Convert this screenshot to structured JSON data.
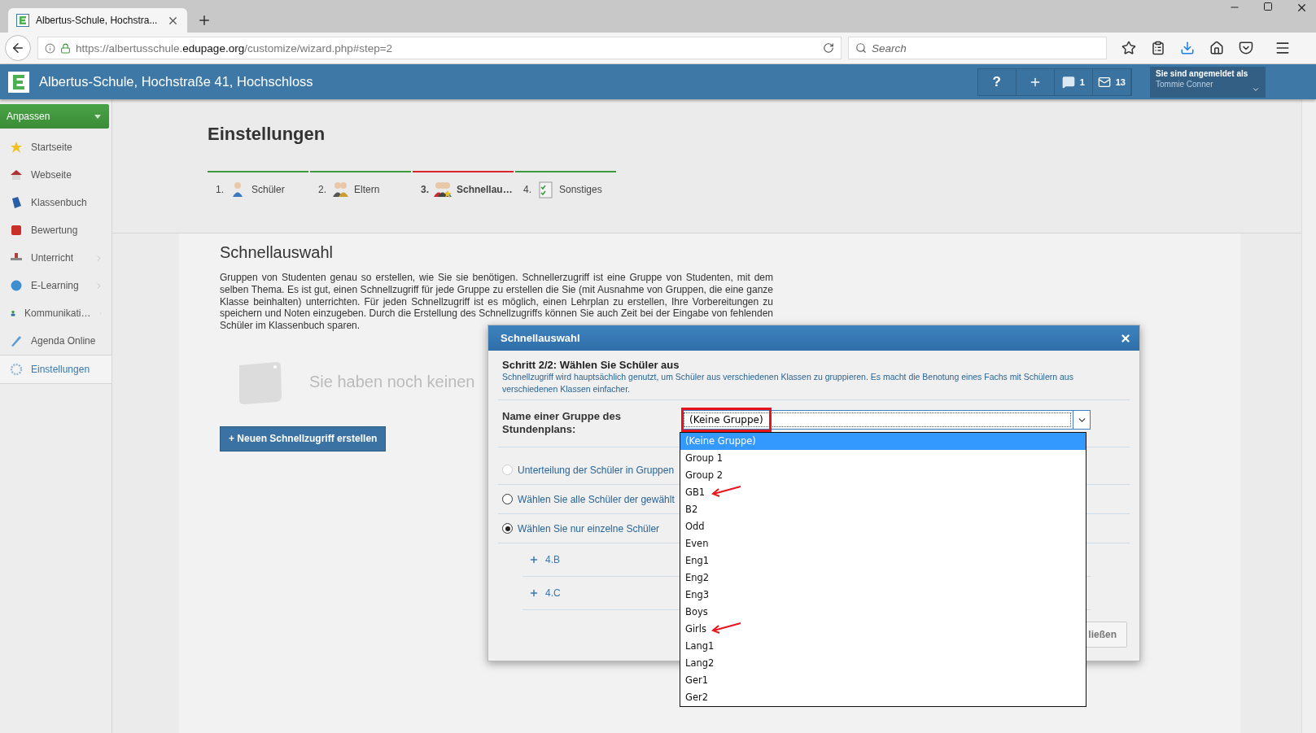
{
  "browser": {
    "tab_title": "Albertus-Schule, Hochstra...",
    "url": {
      "before": "https://albertusschule.",
      "domain": "edupage.org",
      "after": "/customize/wizard.php#step=2"
    },
    "search_placeholder": "Search"
  },
  "app_header": {
    "title": "Albertus-Schule, Hochstraße 41, Hochschloss",
    "help": "?",
    "chat_count": "1",
    "mail_count": "13",
    "user_label": "Sie sind angemeldet als",
    "user_name": "Tommie Conner"
  },
  "sidebar": {
    "menu_button": "Anpassen",
    "items": [
      {
        "label": "Startseite",
        "submenu": false,
        "selected": false
      },
      {
        "label": "Webseite",
        "submenu": false,
        "selected": false
      },
      {
        "label": "Klassenbuch",
        "submenu": false,
        "selected": false
      },
      {
        "label": "Bewertung",
        "submenu": false,
        "selected": false
      },
      {
        "label": "Unterricht",
        "submenu": true,
        "selected": false
      },
      {
        "label": "E-Learning",
        "submenu": true,
        "selected": false
      },
      {
        "label": "Kommunikati…",
        "submenu": true,
        "selected": false
      },
      {
        "label": "Agenda Online",
        "submenu": false,
        "selected": false
      },
      {
        "label": "Einstellungen",
        "submenu": false,
        "selected": true
      }
    ]
  },
  "page": {
    "title": "Einstellungen",
    "steps": [
      {
        "number": "1.",
        "label": "Schüler",
        "selected": false
      },
      {
        "number": "2.",
        "label": "Eltern",
        "selected": false
      },
      {
        "number": "3.",
        "label": "Schnellau…",
        "selected": true
      },
      {
        "number": "4.",
        "label": "Sonstiges",
        "selected": false
      }
    ],
    "heading": "Schnellauswahl",
    "paragraph": "Gruppen von Studenten genau so erstellen, wie Sie sie benötigen. Schnellerzugriff ist eine Gruppe von Studenten, mit dem selben Thema. Es ist gut, einen Schnellzugriff für jede Gruppe zu erstellen die Sie (mit Ausnahme von Gruppen, die eine ganze Klasse beinhalten) unterrichten. Für jeden Schnellzugriff ist es möglich, einen Lehrplan zu erstellen, Ihre Vorbereitungen zu speichern und Noten einzugeben. Durch die Erstellung des Schnellzugriffs können Sie auch Zeit bei der Eingabe von fehlenden Schüler im Klassenbuch sparen.",
    "empty_message": "Sie haben noch keinen",
    "create_button": "+ Neuen Schnellzugriff erstellen"
  },
  "modal": {
    "title": "Schnellauswahl",
    "step_title": "Schritt 2/2: Wählen Sie Schüler aus",
    "description": "Schnellzugriff wird hauptsächlich genutzt, um Schüler aus verschiedenen Klassen zu gruppieren. Es macht die Benotung eines Fachs mit Schülern aus verschiedenen Klassen einfacher.",
    "field_label": "Name einer Gruppe des Stundenplans:",
    "select_value": "(Keine Gruppe)",
    "select_highlighted": true,
    "options": [
      {
        "label": "(Keine Gruppe)",
        "selected": true,
        "marked": false
      },
      {
        "label": "Group 1",
        "selected": false,
        "marked": false
      },
      {
        "label": "Group 2",
        "selected": false,
        "marked": false
      },
      {
        "label": "GB1",
        "selected": false,
        "marked": true
      },
      {
        "label": "B2",
        "selected": false,
        "marked": false
      },
      {
        "label": "Odd",
        "selected": false,
        "marked": false
      },
      {
        "label": "Even",
        "selected": false,
        "marked": false
      },
      {
        "label": "Eng1",
        "selected": false,
        "marked": false
      },
      {
        "label": "Eng2",
        "selected": false,
        "marked": false
      },
      {
        "label": "Eng3",
        "selected": false,
        "marked": false
      },
      {
        "label": "Boys",
        "selected": false,
        "marked": false
      },
      {
        "label": "Girls",
        "selected": false,
        "marked": true
      },
      {
        "label": "Lang1",
        "selected": false,
        "marked": false
      },
      {
        "label": "Lang2",
        "selected": false,
        "marked": false
      },
      {
        "label": "Ger1",
        "selected": false,
        "marked": false
      },
      {
        "label": "Ger2",
        "selected": false,
        "marked": false
      }
    ],
    "radios": [
      {
        "label": "Unterteilung der Schüler in Gruppen",
        "selected": false,
        "disabled": true
      },
      {
        "label": "Wählen Sie alle Schüler der gewählt",
        "selected": false,
        "disabled": false
      },
      {
        "label": "Wählen Sie nur einzelne Schüler",
        "selected": true,
        "disabled": false
      }
    ],
    "classes": [
      {
        "label": "4.B"
      },
      {
        "label": "4.C"
      }
    ],
    "footer_button": "ließen"
  }
}
